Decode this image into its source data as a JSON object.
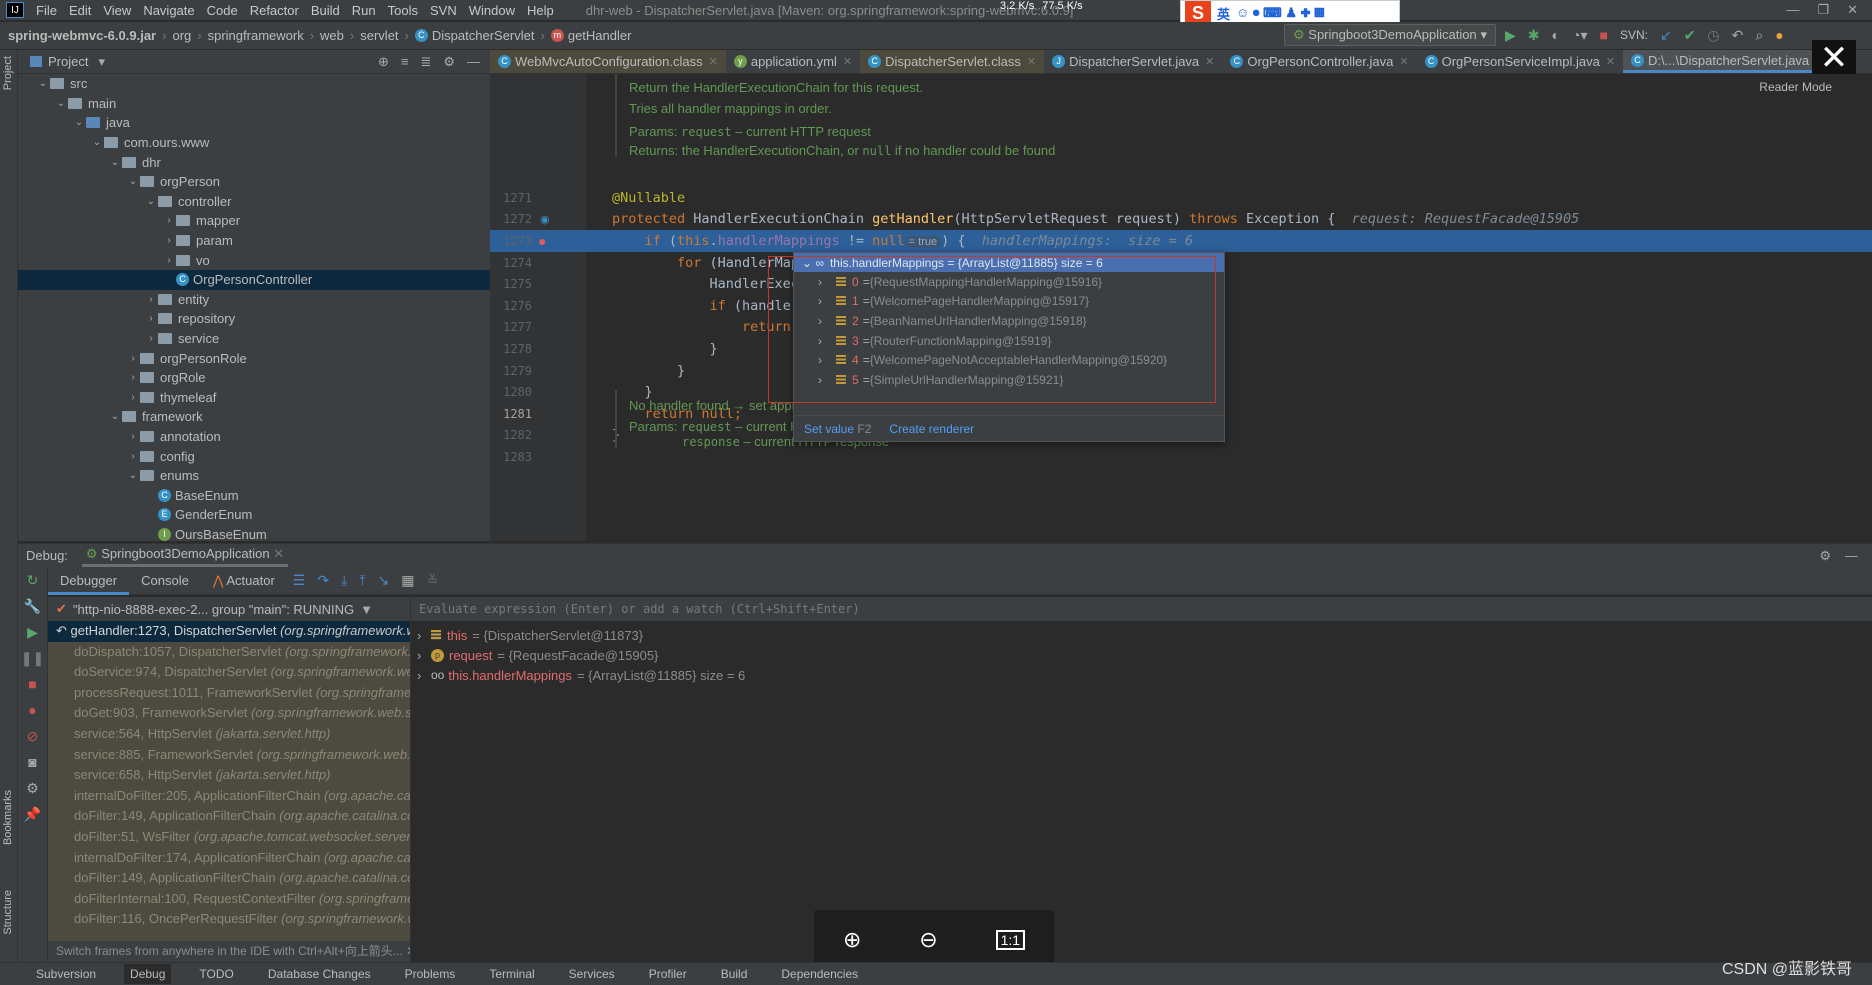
{
  "menubar": {
    "logo": "IJ",
    "items": [
      "File",
      "Edit",
      "View",
      "Navigate",
      "Code",
      "Refactor",
      "Build",
      "Run",
      "Tools",
      "SVN",
      "Window",
      "Help"
    ],
    "window_title": "dhr-web - DispatcherServlet.java [Maven: org.springframework:spring-webmvc:6.0.9]",
    "net_up": "3.2 K/s",
    "net_down": "77.5 K/s"
  },
  "ime": {
    "logo": "S",
    "label": "英"
  },
  "navbar": {
    "crumbs": [
      "spring-webmvc-6.0.9.jar",
      "org",
      "springframework",
      "web",
      "servlet",
      "DispatcherServlet",
      "getHandler"
    ],
    "run_config": "Springboot3DemoApplication",
    "svn_label": "SVN:"
  },
  "project": {
    "title": "Project",
    "tree": [
      {
        "label": "src",
        "depth": 1,
        "kind": "folder",
        "open": true
      },
      {
        "label": "main",
        "depth": 2,
        "kind": "folder",
        "open": true
      },
      {
        "label": "java",
        "depth": 3,
        "kind": "src",
        "open": true
      },
      {
        "label": "com.ours.www",
        "depth": 4,
        "kind": "folder",
        "open": true
      },
      {
        "label": "dhr",
        "depth": 5,
        "kind": "folder",
        "open": true
      },
      {
        "label": "orgPerson",
        "depth": 6,
        "kind": "folder",
        "open": true
      },
      {
        "label": "controller",
        "depth": 7,
        "kind": "folder",
        "open": true
      },
      {
        "label": "mapper",
        "depth": 8,
        "kind": "folder",
        "open": false
      },
      {
        "label": "param",
        "depth": 8,
        "kind": "folder",
        "open": false
      },
      {
        "label": "vo",
        "depth": 8,
        "kind": "folder",
        "open": false
      },
      {
        "label": "OrgPersonController",
        "depth": 8,
        "kind": "class",
        "selected": true
      },
      {
        "label": "entity",
        "depth": 7,
        "kind": "folder",
        "open": false
      },
      {
        "label": "repository",
        "depth": 7,
        "kind": "folder",
        "open": false
      },
      {
        "label": "service",
        "depth": 7,
        "kind": "folder",
        "open": false
      },
      {
        "label": "orgPersonRole",
        "depth": 6,
        "kind": "folder",
        "open": false
      },
      {
        "label": "orgRole",
        "depth": 6,
        "kind": "folder",
        "open": false
      },
      {
        "label": "thymeleaf",
        "depth": 6,
        "kind": "folder",
        "open": false
      },
      {
        "label": "framework",
        "depth": 5,
        "kind": "folder",
        "open": true
      },
      {
        "label": "annotation",
        "depth": 6,
        "kind": "folder",
        "open": false
      },
      {
        "label": "config",
        "depth": 6,
        "kind": "folder",
        "open": false
      },
      {
        "label": "enums",
        "depth": 6,
        "kind": "folder",
        "open": true
      },
      {
        "label": "BaseEnum",
        "depth": 7,
        "kind": "class"
      },
      {
        "label": "GenderEnum",
        "depth": 7,
        "kind": "enum"
      },
      {
        "label": "OursBaseEnum",
        "depth": 7,
        "kind": "interface"
      }
    ]
  },
  "tabs": [
    {
      "label": "WebMvcAutoConfiguration.class",
      "icon": "C",
      "cls": true
    },
    {
      "label": "application.yml",
      "icon": "yml"
    },
    {
      "label": "DispatcherServlet.class",
      "icon": "C",
      "cls": true
    },
    {
      "label": "DispatcherServlet.java",
      "icon": "J"
    },
    {
      "label": "OrgPersonController.java",
      "icon": "C"
    },
    {
      "label": "OrgPersonServiceImpl.java",
      "icon": "C"
    },
    {
      "label": "D:\\...\\DispatcherServlet.java",
      "icon": "C",
      "active": true
    }
  ],
  "editor": {
    "reader_mode": "Reader Mode",
    "doc_top": [
      "Return the HandlerExecutionChain for this request.",
      "Tries all handler mappings in order."
    ],
    "doc_params_label": "Params:",
    "doc_param1_code": "request",
    "doc_param1_text": " – current HTTP request",
    "doc_returns_pre": "Returns: the HandlerExecutionChain, or ",
    "doc_returns_code": "null",
    "doc_returns_post": " if no handler could be found",
    "doc_bottom_title": "No handler found → set appropriate HTTP response status.",
    "doc_bottom_param2_code": "response",
    "doc_bottom_param2_text": " – current HTTP response",
    "current_line": "1281",
    "lines": [
      {
        "n": "1271",
        "tokens": [
          {
            "t": "@Nullable",
            "c": "an"
          }
        ]
      },
      {
        "n": "1272",
        "tokens": [
          {
            "t": "protected ",
            "c": "kw"
          },
          {
            "t": "HandlerExecutionChain ",
            "c": "tx"
          },
          {
            "t": "getHandler",
            "c": "fn"
          },
          {
            "t": "(HttpServletRequest request) ",
            "c": "tx"
          },
          {
            "t": "throws ",
            "c": "kw"
          },
          {
            "t": "Exception {  ",
            "c": "tx"
          },
          {
            "t": "request: RequestFacade@15905",
            "c": "hint"
          }
        ]
      },
      {
        "n": "1273",
        "hl": true,
        "tokens": [
          {
            "t": "    if ",
            "c": "kw"
          },
          {
            "t": "(",
            "c": "tx"
          },
          {
            "t": "this",
            "c": "kw"
          },
          {
            "t": ".",
            "c": "tx"
          },
          {
            "t": "handlerMappings",
            "c": "fd"
          },
          {
            "t": " != ",
            "c": "tx"
          },
          {
            "t": "null",
            "c": "kw"
          },
          {
            "t": "= true",
            "c": "pill"
          },
          {
            "t": ") {  ",
            "c": "tx"
          },
          {
            "t": "handlerMappings:  size = 6",
            "c": "hint"
          }
        ]
      },
      {
        "n": "1274",
        "tokens": [
          {
            "t": "        for ",
            "c": "kw"
          },
          {
            "t": "(HandlerMap",
            "c": "tx"
          }
        ]
      },
      {
        "n": "1275",
        "tokens": [
          {
            "t": "            HandlerExec",
            "c": "tx"
          }
        ]
      },
      {
        "n": "1276",
        "tokens": [
          {
            "t": "            if ",
            "c": "kw"
          },
          {
            "t": "(handler",
            "c": "tx"
          }
        ]
      },
      {
        "n": "1277",
        "tokens": [
          {
            "t": "                return",
            "c": "kw"
          }
        ]
      },
      {
        "n": "1278",
        "tokens": [
          {
            "t": "            }",
            "c": "tx"
          }
        ]
      },
      {
        "n": "1279",
        "tokens": [
          {
            "t": "        }",
            "c": "tx"
          }
        ]
      },
      {
        "n": "1280",
        "tokens": [
          {
            "t": "    }",
            "c": "tx"
          }
        ]
      },
      {
        "n": "1281",
        "tokens": [
          {
            "t": "    return null",
            "c": "kw"
          },
          {
            "t": ";",
            "c": "kw"
          }
        ]
      },
      {
        "n": "1282",
        "tokens": [
          {
            "t": "}",
            "c": "tx"
          }
        ]
      },
      {
        "n": "1283",
        "tokens": []
      }
    ]
  },
  "popup": {
    "header": "this.handlerMappings = {ArrayList@11885}  size = 6",
    "items": [
      {
        "idx": "0",
        "value": "{RequestMappingHandlerMapping@15916}"
      },
      {
        "idx": "1",
        "value": "{WelcomePageHandlerMapping@15917}"
      },
      {
        "idx": "2",
        "value": "{BeanNameUrlHandlerMapping@15918}"
      },
      {
        "idx": "3",
        "value": "{RouterFunctionMapping@15919}"
      },
      {
        "idx": "4",
        "value": "{WelcomePageNotAcceptableHandlerMapping@15920}"
      },
      {
        "idx": "5",
        "value": "{SimpleUrlHandlerMapping@15921}"
      }
    ],
    "set_value": "Set value",
    "set_value_key": "F2",
    "create_renderer": "Create renderer"
  },
  "debug": {
    "label": "Debug:",
    "session": "Springboot3DemoApplication",
    "tabs": [
      "Debugger",
      "Console",
      "Actuator"
    ],
    "thread": "\"http-nio-8888-exec-2... group \"main\": RUNNING",
    "frames": [
      {
        "m": "getHandler:1273, DispatcherServlet",
        "p": "(org.springframework.web.servlet)"
      },
      {
        "m": "doDispatch:1057, DispatcherServlet",
        "p": "(org.springframework.web.servlet)"
      },
      {
        "m": "doService:974, DispatcherServlet",
        "p": "(org.springframework.web.servlet)"
      },
      {
        "m": "processRequest:1011, FrameworkServlet",
        "p": "(org.springframework.web.servlet)"
      },
      {
        "m": "doGet:903, FrameworkServlet",
        "p": "(org.springframework.web.servlet)"
      },
      {
        "m": "service:564, HttpServlet",
        "p": "(jakarta.servlet.http)"
      },
      {
        "m": "service:885, FrameworkServlet",
        "p": "(org.springframework.web.servlet)"
      },
      {
        "m": "service:658, HttpServlet",
        "p": "(jakarta.servlet.http)"
      },
      {
        "m": "internalDoFilter:205, ApplicationFilterChain",
        "p": "(org.apache.catalina.core)"
      },
      {
        "m": "doFilter:149, ApplicationFilterChain",
        "p": "(org.apache.catalina.core)"
      },
      {
        "m": "doFilter:51, WsFilter",
        "p": "(org.apache.tomcat.websocket.server)"
      },
      {
        "m": "internalDoFilter:174, ApplicationFilterChain",
        "p": "(org.apache.catalina.core)"
      },
      {
        "m": "doFilter:149, ApplicationFilterChain",
        "p": "(org.apache.catalina.core)"
      },
      {
        "m": "doFilterInternal:100, RequestContextFilter",
        "p": "(org.springframework.web.filter)"
      },
      {
        "m": "doFilter:116, OncePerRequestFilter",
        "p": "(org.springframework.web.filter)"
      }
    ],
    "hint": "Switch frames from anywhere in the IDE with Ctrl+Alt+向上箭头...",
    "eval_placeholder": "Evaluate expression (Enter) or add a watch (Ctrl+Shift+Enter)",
    "vars": [
      {
        "icon": "field",
        "name": "this",
        "value": "= {DispatcherServlet@11873}"
      },
      {
        "icon": "param",
        "name": "request",
        "value": "= {RequestFacade@15905}"
      },
      {
        "icon": "watch",
        "name": "this.handlerMappings",
        "value": "= {ArrayList@11885}  size = 6"
      }
    ]
  },
  "left_strip": {
    "project": "Project",
    "bookmarks": "Bookmarks",
    "structure": "Structure"
  },
  "viewer": {
    "zoom_in": "⊕",
    "zoom_out": "⊖",
    "actual_size": "1:1"
  },
  "statusbar": [
    "Subversion",
    "Debug",
    "TODO",
    "Database Changes",
    "Problems",
    "Terminal",
    "Services",
    "Profiler",
    "Build",
    "Dependencies"
  ],
  "watermark": "CSDN @蓝影铁哥"
}
